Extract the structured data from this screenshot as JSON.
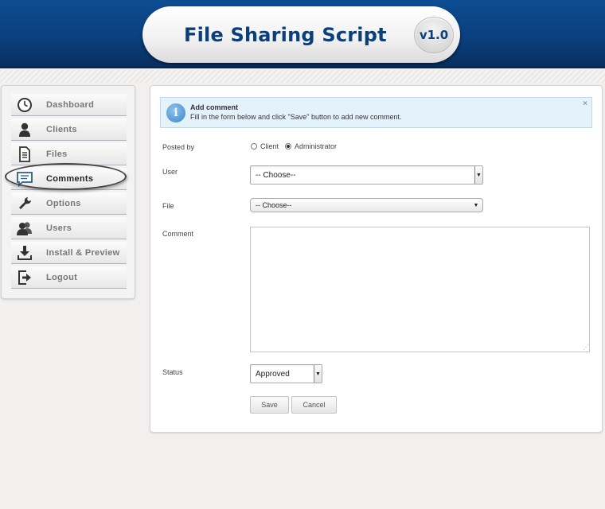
{
  "header": {
    "title": "File Sharing Script",
    "version": "v1.0"
  },
  "sidebar": {
    "items": [
      {
        "label": "Dashboard",
        "icon": "clock-icon",
        "active": false
      },
      {
        "label": "Clients",
        "icon": "person-icon",
        "active": false
      },
      {
        "label": "Files",
        "icon": "document-icon",
        "active": false
      },
      {
        "label": "Comments",
        "icon": "speech-bubble-icon",
        "active": true
      },
      {
        "label": "Options",
        "icon": "wrench-icon",
        "active": false
      },
      {
        "label": "Users",
        "icon": "users-icon",
        "active": false
      },
      {
        "label": "Install & Preview",
        "icon": "download-icon",
        "active": false
      },
      {
        "label": "Logout",
        "icon": "logout-icon",
        "active": false
      }
    ]
  },
  "notice": {
    "title": "Add comment",
    "text": "Fill in the form below and click \"Save\" button to add new comment.",
    "close": "×"
  },
  "form": {
    "posted_by_label": "Posted by",
    "posted_by_options": [
      {
        "label": "Client",
        "checked": false
      },
      {
        "label": "Administrator",
        "checked": true
      }
    ],
    "user_label": "User",
    "user_value": "-- Choose--",
    "file_label": "File",
    "file_value": "-- Choose--",
    "comment_label": "Comment",
    "comment_value": "",
    "status_label": "Status",
    "status_value": "Approved",
    "save_label": "Save",
    "cancel_label": "Cancel"
  },
  "colors": {
    "header_blue": "#0a3f7c",
    "notice_bg": "#e4f2fb",
    "active_ring": "#444444"
  }
}
